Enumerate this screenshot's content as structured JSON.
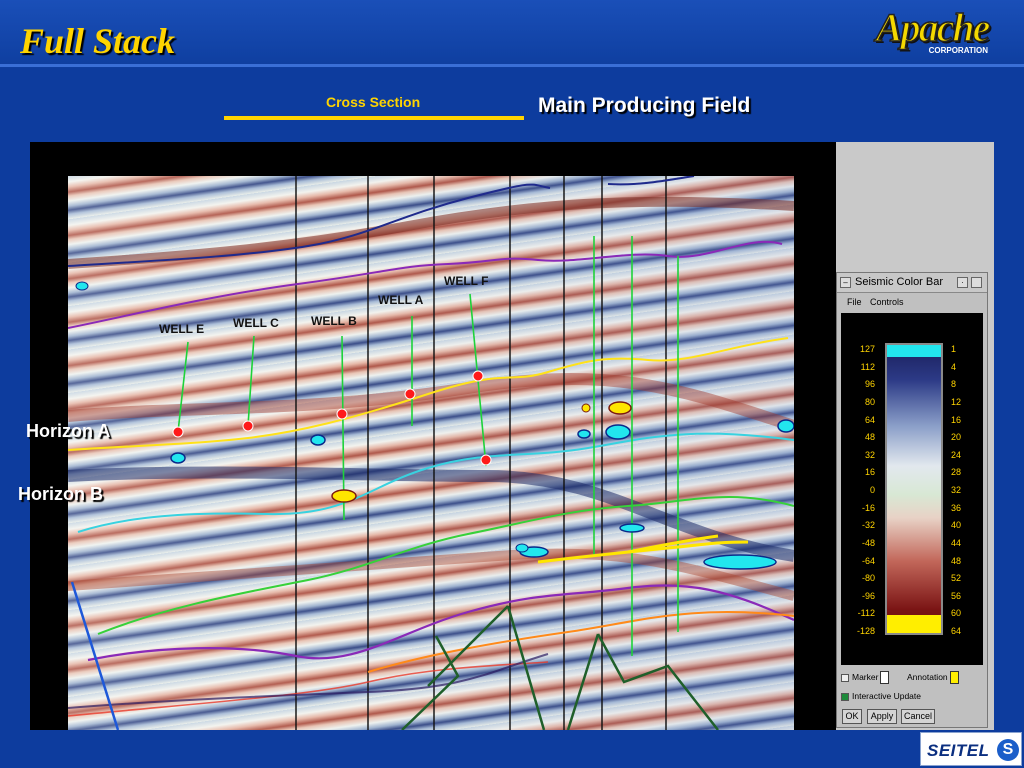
{
  "slide": {
    "title": "Full Stack",
    "cross_section_label": "Cross Section",
    "field_title": "Main Producing Field"
  },
  "logos": {
    "apache": {
      "word": "Apache",
      "corp": "CORPORATION"
    },
    "seitel": {
      "word": "SEITEL"
    }
  },
  "plot": {
    "horizon_labels": [
      "Horizon A",
      "Horizon B"
    ],
    "wells": [
      "WELL E",
      "WELL C",
      "WELL B",
      "WELL A",
      "WELL F"
    ],
    "colors": {
      "horizon_a": "#ffe21a",
      "horizon_b": "#39d2e0",
      "dark_blue_horizon": "#1f2a8c",
      "purple_horizon": "#8a2ab8",
      "green_horizon": "#37d13a",
      "orange_horizon": "#ff8a1a",
      "fault": "#1f5f2a",
      "well_track": "#1ed23a",
      "bright_spot_yellow": "#ffe600",
      "bright_spot_cyan": "#22e6ee",
      "marker": "#ff1a1a"
    }
  },
  "color_bar_dialog": {
    "title": "Seismic Color Bar",
    "menu": [
      "File",
      "Controls"
    ],
    "left_ticks": [
      "127",
      "112",
      "96",
      "80",
      "64",
      "48",
      "32",
      "16",
      "0",
      "-16",
      "-32",
      "-48",
      "-64",
      "-80",
      "-96",
      "-112",
      "-128"
    ],
    "right_ticks": [
      "1",
      "4",
      "8",
      "12",
      "16",
      "20",
      "24",
      "28",
      "32",
      "36",
      "40",
      "44",
      "48",
      "52",
      "56",
      "60",
      "64"
    ],
    "marker_label": "Marker",
    "annotation_label": "Annotation",
    "interactive_update_label": "Interactive Update",
    "interactive_update_checked": true,
    "marker_checked": false,
    "marker_color": "#ffffff",
    "annotation_color": "#ffee00",
    "buttons": [
      "OK",
      "Apply",
      "Cancel"
    ]
  }
}
